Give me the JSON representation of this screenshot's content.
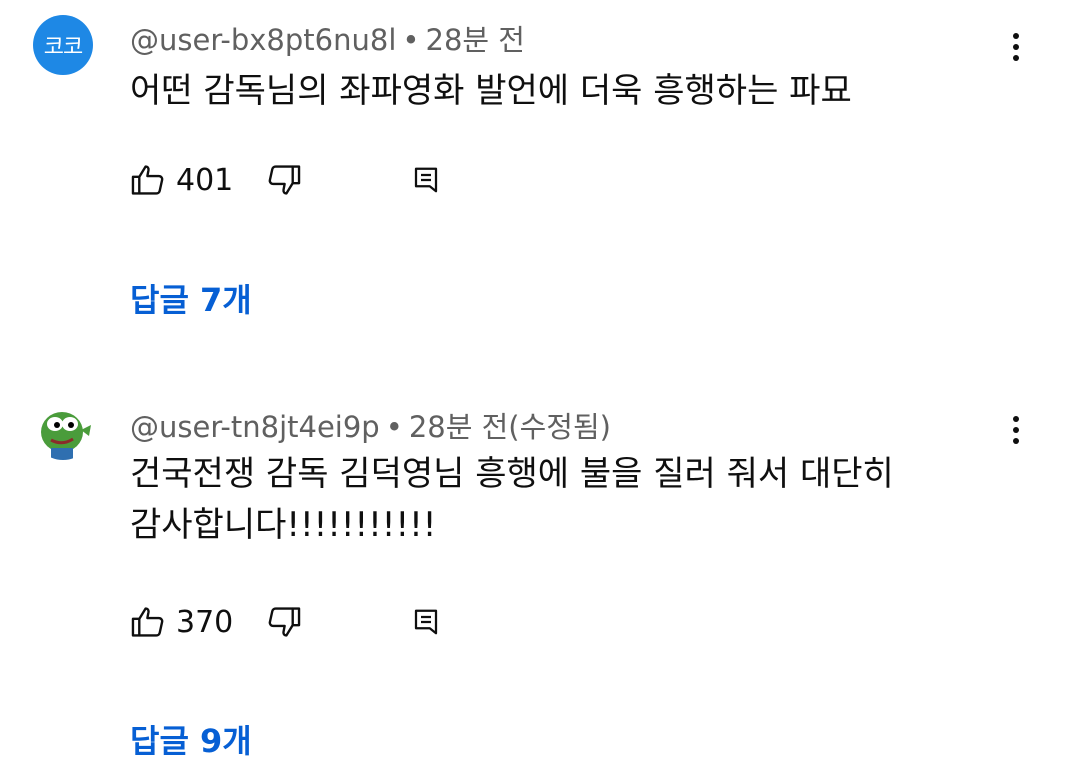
{
  "comments": [
    {
      "avatar_text": "코코",
      "username": "@user-bx8pt6nu8l",
      "separator": "•",
      "time": "28분 전",
      "text": "어떤 감독님의 좌파영화 발언에 더욱 흥행하는 파묘",
      "likes": "401",
      "replies_label": "답글 7개"
    },
    {
      "username": "@user-tn8jt4ei9p",
      "separator": "•",
      "time": "28분 전(수정됨)",
      "text_line1": "건국전쟁 감독 김덕영님 흥행에 불을 질러 줘서 대단히",
      "text_line2": "감사합니다!!!!!!!!!!!",
      "likes": "370",
      "replies_label": "답글 9개"
    }
  ],
  "colors": {
    "replies_link": "#065fd4",
    "avatar_bg": "#1e88e5",
    "meta_text": "#606060"
  },
  "icons": {
    "like": "thumbs-up-icon",
    "dislike": "thumbs-down-icon",
    "reply": "reply-comment-icon",
    "more": "vertical-ellipsis-icon",
    "avatar2": "green-frog-avatar"
  }
}
